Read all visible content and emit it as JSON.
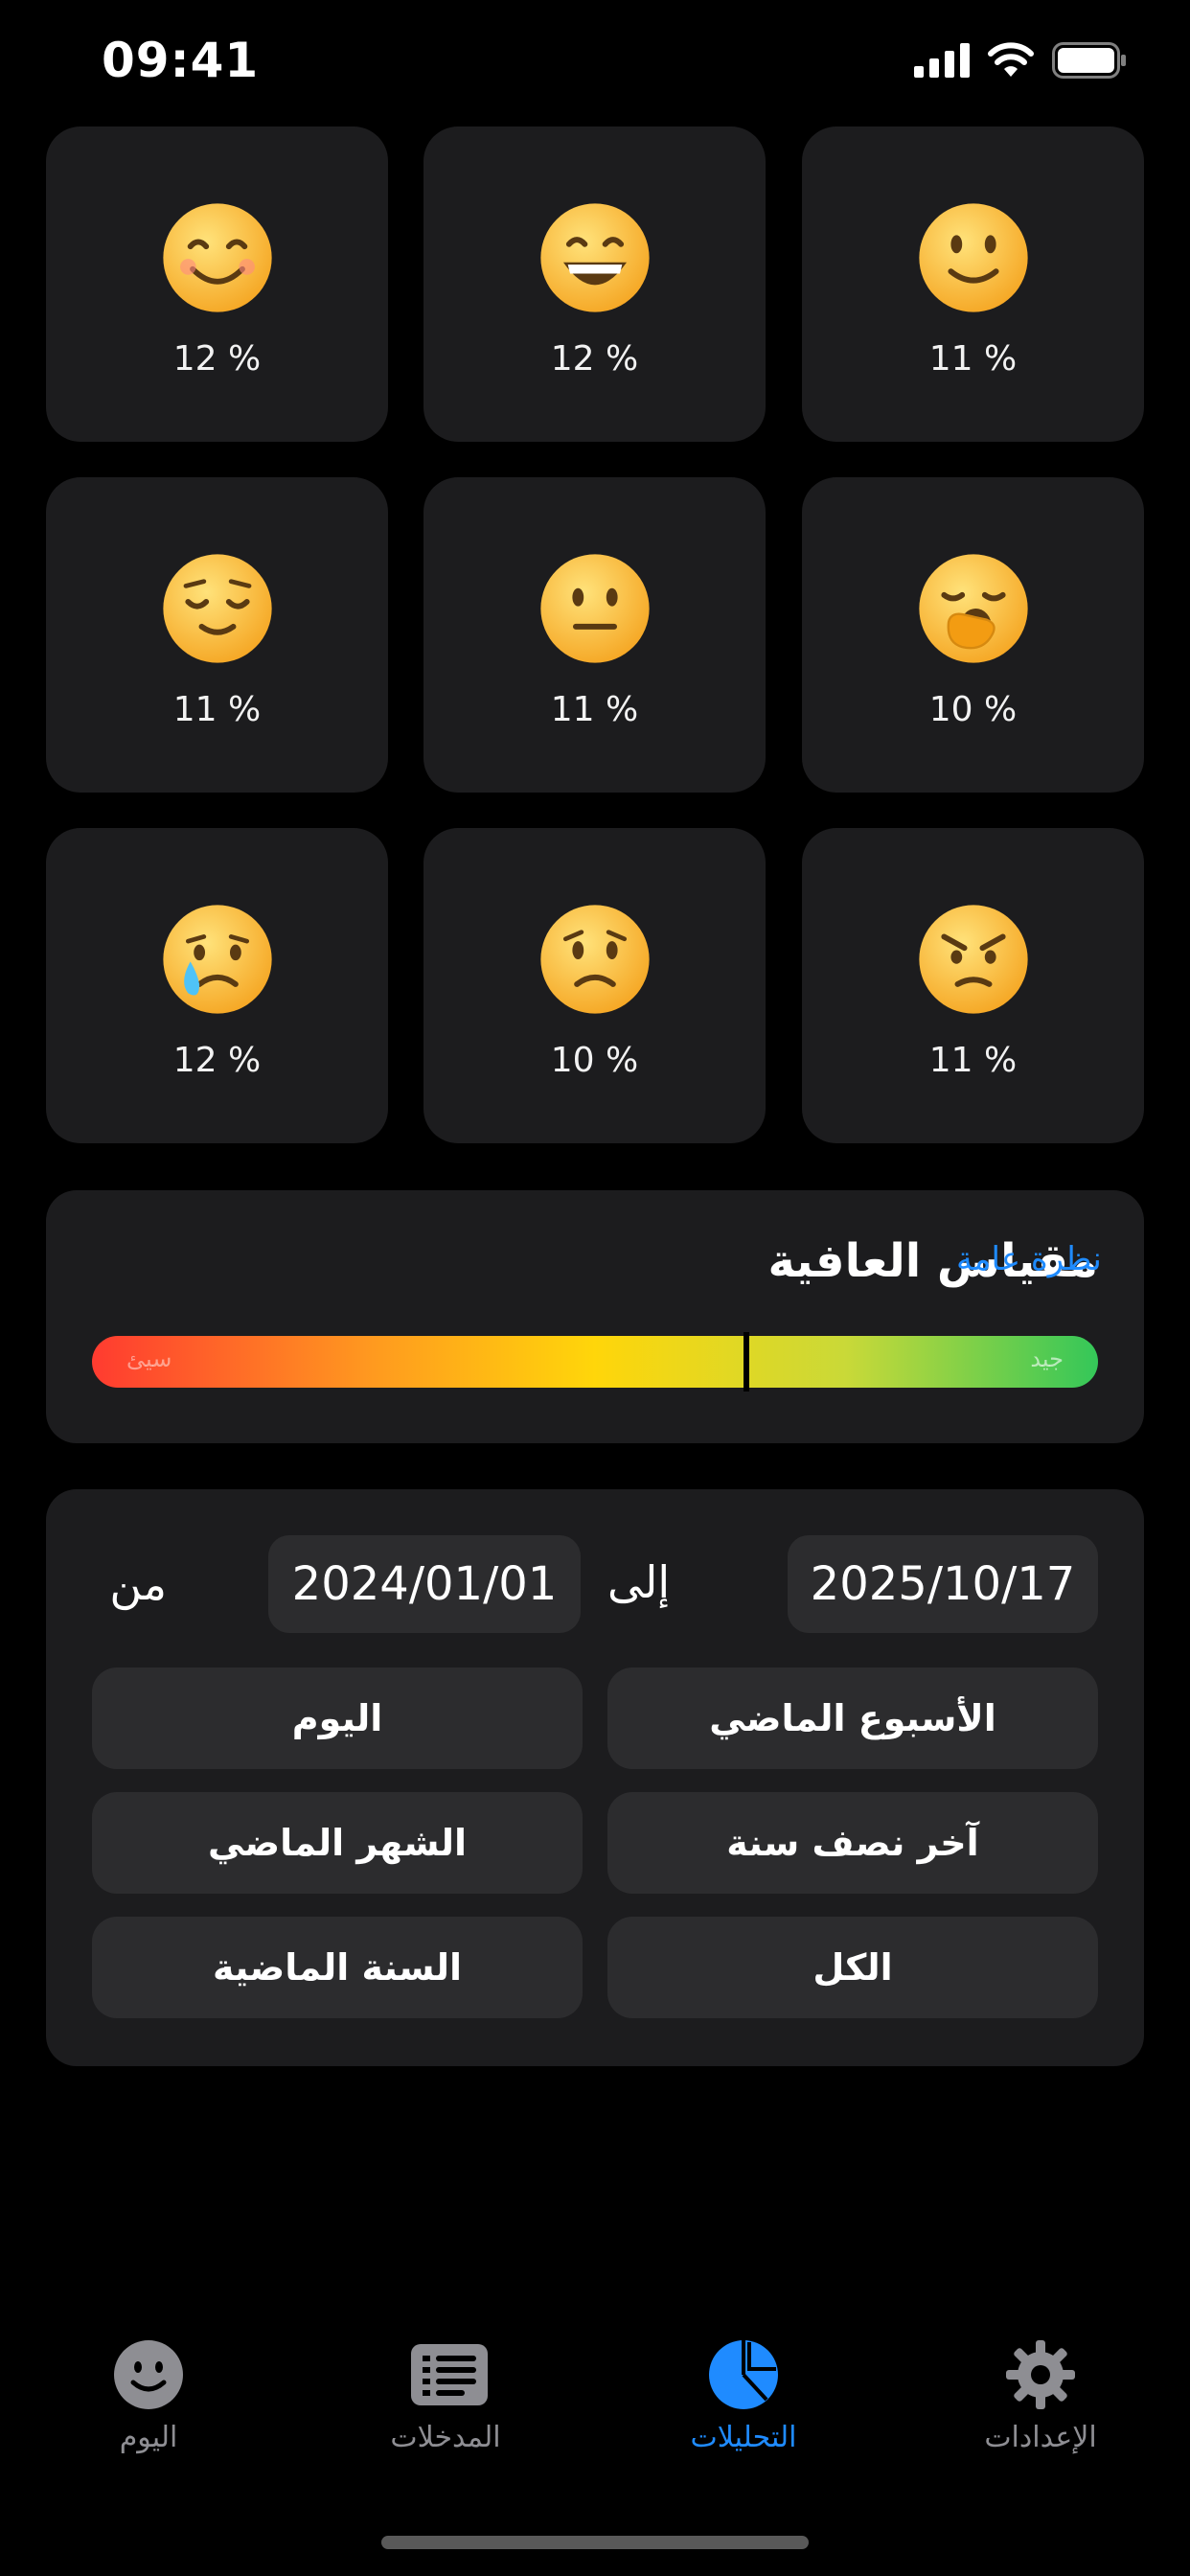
{
  "status": {
    "time": "09:41"
  },
  "moods": [
    {
      "emoji": "😊",
      "percent": "12 %"
    },
    {
      "emoji": "😄",
      "percent": "12 %"
    },
    {
      "emoji": "🙂",
      "percent": "11 %"
    },
    {
      "emoji": "😌",
      "percent": "11 %"
    },
    {
      "emoji": "😐",
      "percent": "11 %"
    },
    {
      "emoji": "🥱",
      "percent": "10 %"
    },
    {
      "emoji": "😢",
      "percent": "12 %"
    },
    {
      "emoji": "😟",
      "percent": "10 %"
    },
    {
      "emoji": "😠",
      "percent": "11 %"
    }
  ],
  "wellbeing": {
    "title": "مقياس العافية",
    "overview_link": "نظرة عامة",
    "bad_label": "سيئ",
    "good_label": "جيد",
    "marker_fraction": 0.65,
    "colors": {
      "bad": "#ff3b30",
      "mid": "#ffd60a",
      "good": "#34c759"
    }
  },
  "range": {
    "from_label": "من",
    "to_label": "إلى",
    "from_date": "2024/01/01",
    "to_date": "2025/10/17",
    "presets": {
      "today": "اليوم",
      "last_week": "الأسبوع الماضي",
      "last_month": "الشهر الماضي",
      "last_half_year": "آخر نصف سنة",
      "last_year": "السنة الماضية",
      "all": "الكل"
    }
  },
  "tabs": {
    "today": {
      "label": "اليوم",
      "icon": "smiley-icon"
    },
    "entries": {
      "label": "المدخلات",
      "icon": "list-icon"
    },
    "analytics": {
      "label": "التحليلات",
      "icon": "pie-chart-icon"
    },
    "settings": {
      "label": "الإعدادات",
      "icon": "gear-icon"
    }
  },
  "accent_color": "#1f8bff"
}
